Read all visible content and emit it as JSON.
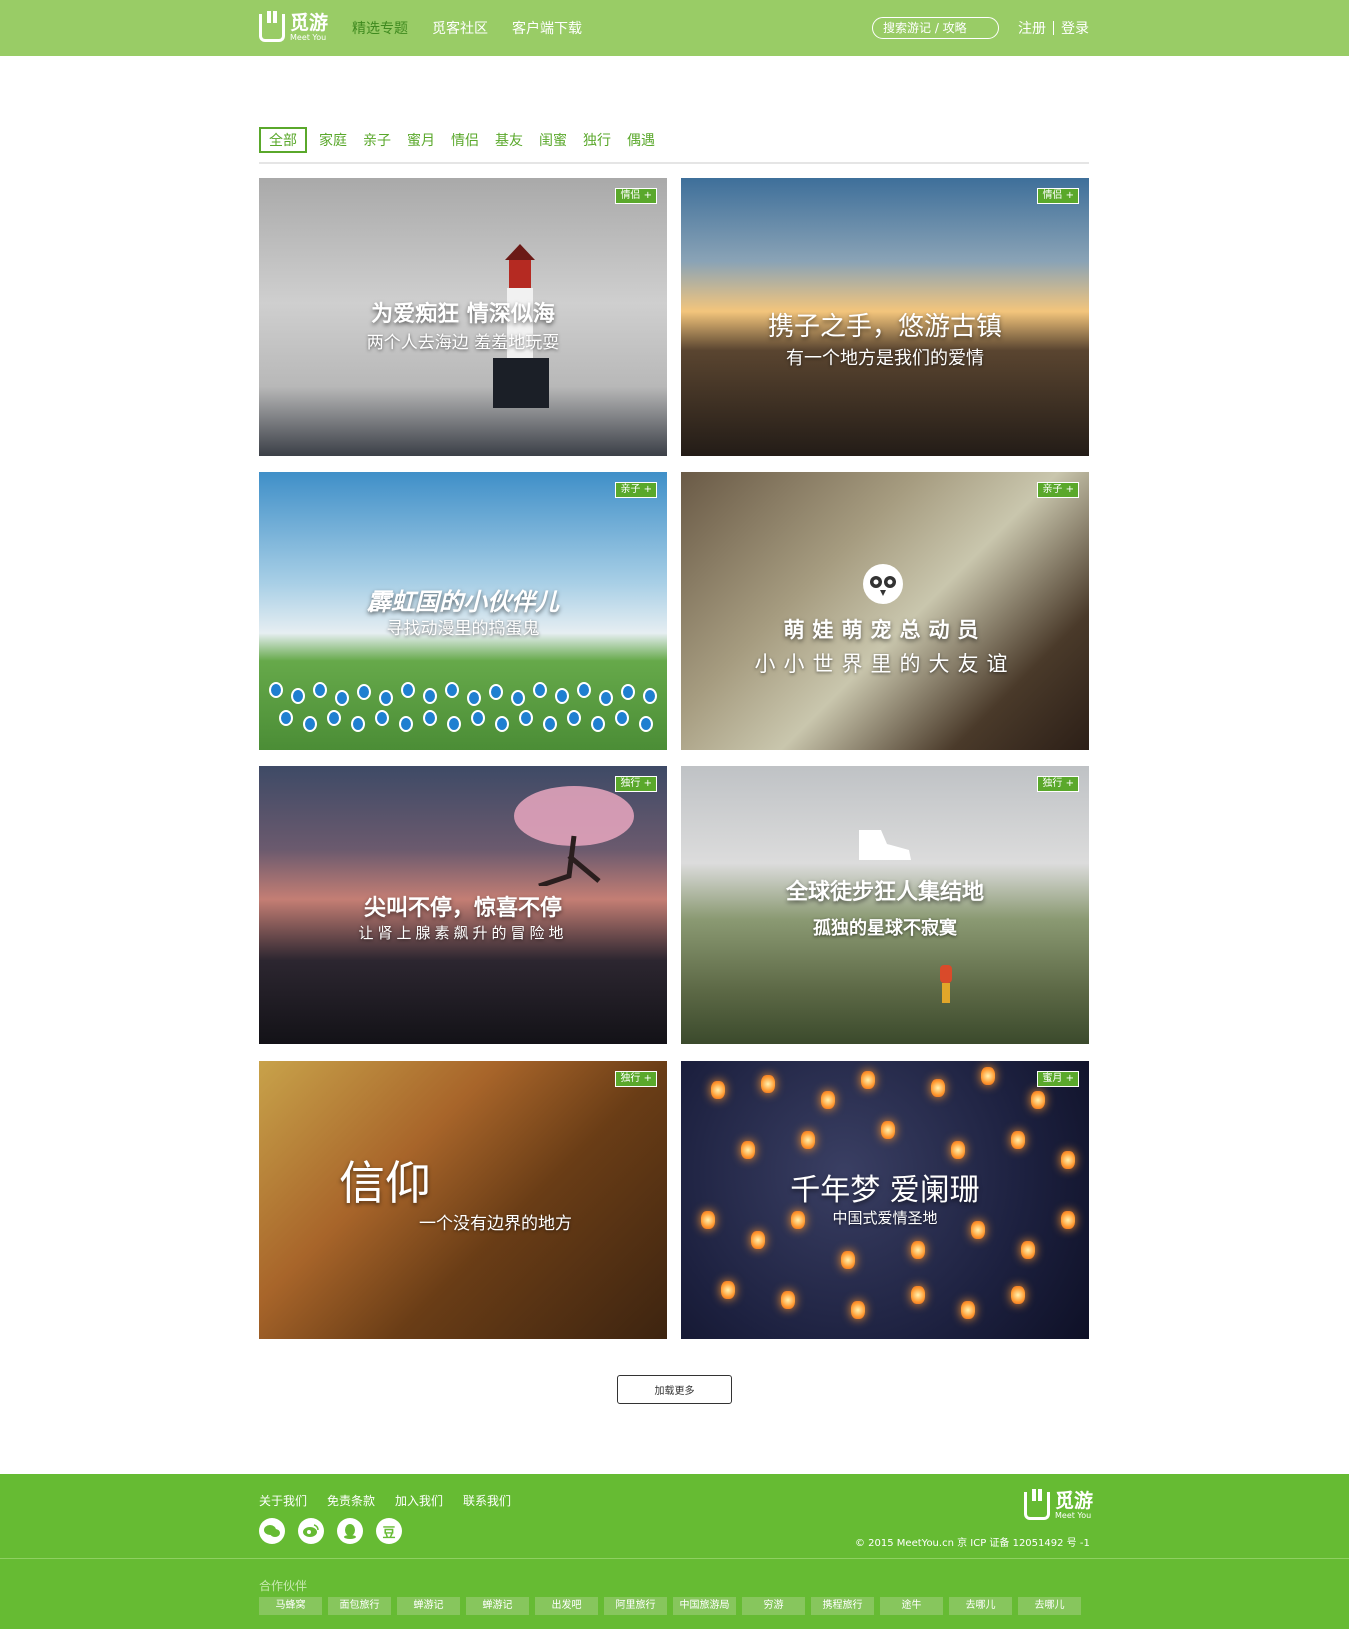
{
  "header": {
    "logo_cn": "觅游",
    "logo_en": "Meet You",
    "nav": [
      "精选专题",
      "觅客社区",
      "客户端下载"
    ],
    "search_placeholder": "搜索游记 / 攻略",
    "register": "注册",
    "login": "登录",
    "colors": {
      "bar": "#99cc66",
      "active": "#3f8a1f"
    }
  },
  "filters": [
    "全部",
    "家庭",
    "亲子",
    "蜜月",
    "情侣",
    "基友",
    "闺蜜",
    "独行",
    "偶遇"
  ],
  "cards": [
    {
      "tag": "情侣 +",
      "title": "为爱痴狂 情深似海",
      "subtitle": "两个人去海边  羞羞地玩耍"
    },
    {
      "tag": "情侣 +",
      "title": "携子之手，悠游古镇",
      "subtitle": "有一个地方是我们的爱情"
    },
    {
      "tag": "亲子 +",
      "title": "霹虹国的小伙伴儿",
      "subtitle": "寻找动漫里的捣蛋鬼"
    },
    {
      "tag": "亲子 +",
      "title": "萌娃萌宠总动员",
      "subtitle": "小小世界里的大友谊"
    },
    {
      "tag": "独行 +",
      "title": "尖叫不停，惊喜不停",
      "subtitle": "让肾上腺素飙升的冒险地"
    },
    {
      "tag": "独行 +",
      "title": "全球徒步狂人集结地",
      "subtitle": "孤独的星球不寂寞"
    },
    {
      "tag": "独行 +",
      "title": "信仰",
      "subtitle": "一个没有边界的地方"
    },
    {
      "tag": "蜜月 +",
      "title": "千年梦 爱阑珊",
      "subtitle": "中国式爱情圣地"
    }
  ],
  "load_more": "加载更多",
  "footer": {
    "links": [
      "关于我们",
      "免责条款",
      "加入我们",
      "联系我们"
    ],
    "social_icons": [
      "wechat-icon",
      "weibo-icon",
      "qq-icon",
      "douban-icon"
    ],
    "douban_glyph": "豆",
    "copyright": "© 2015 MeetYou.cn   京 ICP 证备 12051492 号 -1",
    "partners_title": "合作伙伴",
    "partners": [
      "马蜂窝",
      "面包旅行",
      "蝉游记",
      "蝉游记",
      "出发吧",
      "阿里旅行",
      "中国旅游局",
      "穷游",
      "携程旅行",
      "途牛",
      "去哪儿",
      "去哪儿"
    ],
    "colors": {
      "bg": "#66bb33"
    }
  }
}
